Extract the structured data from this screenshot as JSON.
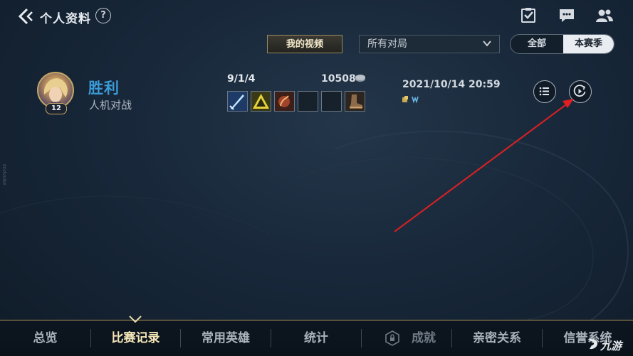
{
  "header": {
    "title": "个人资料",
    "help_label": "?"
  },
  "filters": {
    "video_button": "我的视频",
    "mode_selected": "所有对局",
    "toggle": {
      "all": "全部",
      "season": "本赛季",
      "selected": "本赛季"
    }
  },
  "match": {
    "result": "胜利",
    "mode": "人机对战",
    "hero_level": "12",
    "kda": "9/1/4",
    "gold": "10508",
    "datetime": "2021/10/14 20:59",
    "items": [
      "blade-item",
      "triangle-item",
      "flame-item",
      "empty-slot",
      "empty-slot",
      "boots-item"
    ]
  },
  "nav": {
    "items": [
      "总览",
      "比赛记录",
      "常用英雄",
      "统计",
      "成就",
      "亲密关系",
      "信誉系统"
    ],
    "active": "比赛记录"
  },
  "watermark": "九游",
  "side_text": "4ndvo6e",
  "colors": {
    "accent_gold": "#c4a666",
    "win_blue": "#3b9bd6",
    "arrow_red": "#e02020"
  }
}
